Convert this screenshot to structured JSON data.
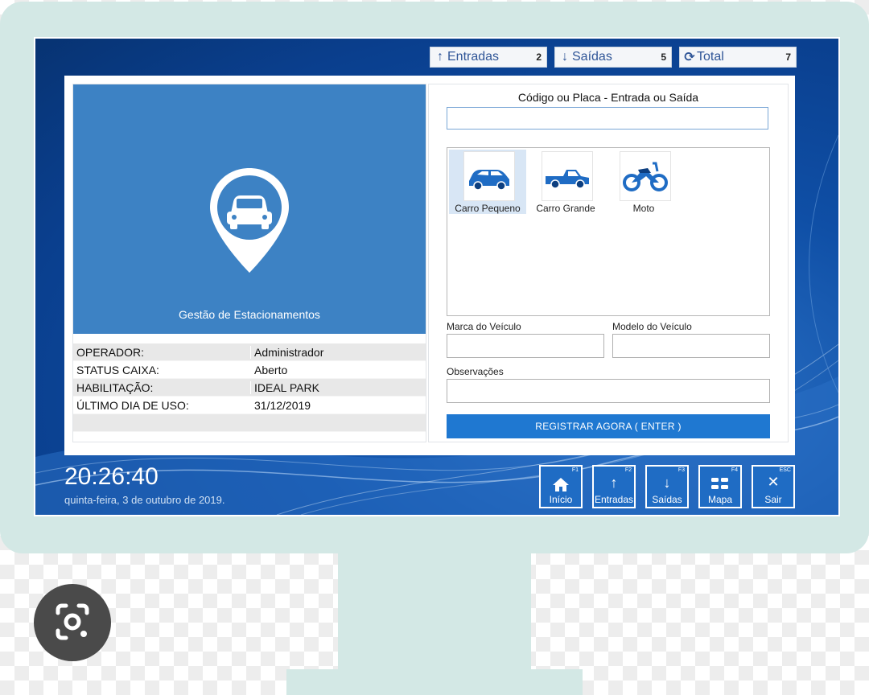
{
  "counters": [
    {
      "icon": "arrow-up-icon",
      "label": "Entradas",
      "count": "2"
    },
    {
      "icon": "arrow-down-icon",
      "label": "Saídas",
      "count": "5"
    },
    {
      "icon": "refresh-icon",
      "label": "Total",
      "count": "7"
    }
  ],
  "brand": {
    "title": "Gestão de Estacionamentos",
    "icon": "car-location-pin-icon"
  },
  "info": [
    {
      "key": "OPERADOR:",
      "value": "Administrador"
    },
    {
      "key": "STATUS CAIXA:",
      "value": "Aberto"
    },
    {
      "key": "HABILITAÇÃO:",
      "value": "IDEAL PARK"
    },
    {
      "key": "ÚLTIMO DIA DE USO:",
      "value": "31/12/2019"
    },
    {
      "key": "",
      "value": ""
    }
  ],
  "form": {
    "code_title": "Código ou Placa - Entrada ou Saída",
    "code_value": "",
    "vehicles": [
      {
        "label": "Carro Pequeno",
        "icon": "small-car-icon",
        "selected": true
      },
      {
        "label": "Carro Grande",
        "icon": "pickup-truck-icon",
        "selected": false
      },
      {
        "label": "Moto",
        "icon": "motorcycle-icon",
        "selected": false
      }
    ],
    "brand_label": "Marca do Veículo",
    "model_label": "Modelo do Veículo",
    "notes_label": "Observações",
    "register_label": "REGISTRAR AGORA ( ENTER )"
  },
  "clock": {
    "time": "20:26:40",
    "date": "quinta-feira, 3 de outubro de 2019."
  },
  "function_buttons": [
    {
      "key": "F1",
      "label": "Início",
      "icon": "home-icon"
    },
    {
      "key": "F2",
      "label": "Entradas",
      "icon": "arrow-up-icon"
    },
    {
      "key": "F3",
      "label": "Saídas",
      "icon": "arrow-down-icon"
    },
    {
      "key": "F4",
      "label": "Mapa",
      "icon": "parking-map-icon"
    },
    {
      "key": "ESC",
      "label": "Sair",
      "icon": "close-icon"
    }
  ],
  "colors": {
    "accent": "#1f78d1",
    "brand_panel": "#3d82c4",
    "screen_bg": "#0f4fa6",
    "monitor": "#d3e8e5"
  }
}
